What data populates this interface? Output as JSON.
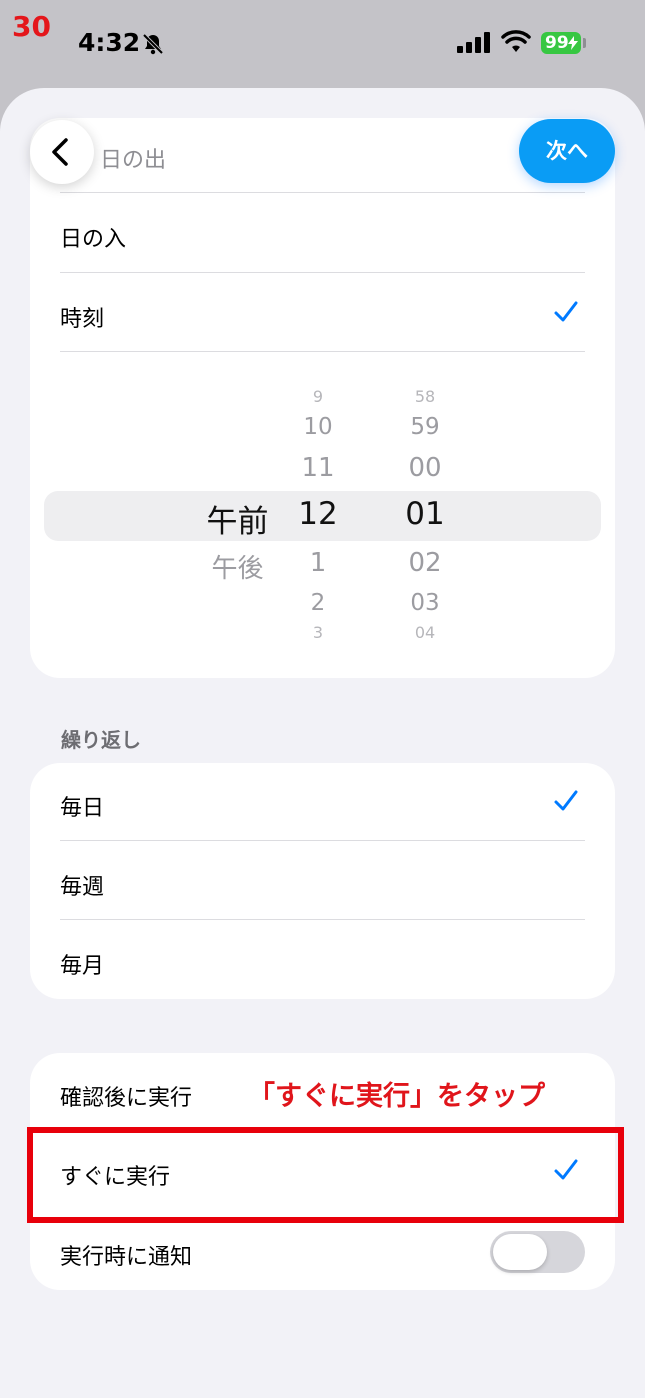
{
  "step_number": "30",
  "status_bar": {
    "time": "4:32",
    "battery": "99"
  },
  "nav": {
    "next_label": "次へ",
    "partial_row_label": "日の出"
  },
  "time_options": [
    {
      "label": "日の入",
      "checked": false
    },
    {
      "label": "時刻",
      "checked": true
    }
  ],
  "time_picker": {
    "period": {
      "above": [],
      "selected": "午前",
      "below": [
        "午後"
      ]
    },
    "hour": {
      "above": [
        "9",
        "10",
        "11"
      ],
      "selected": "12",
      "below": [
        "1",
        "2",
        "3"
      ]
    },
    "minute": {
      "above": [
        "58",
        "59",
        "00"
      ],
      "selected": "01",
      "below": [
        "02",
        "03",
        "04"
      ]
    }
  },
  "repeat": {
    "header": "繰り返し",
    "options": [
      {
        "label": "毎日",
        "checked": true
      },
      {
        "label": "毎週",
        "checked": false
      },
      {
        "label": "毎月",
        "checked": false
      }
    ]
  },
  "run": {
    "options": [
      {
        "label": "確認後に実行",
        "checked": false
      },
      {
        "label": "すぐに実行",
        "checked": true
      }
    ],
    "notify_label": "実行時に通知",
    "notify_on": false
  },
  "annotation": "「すぐに実行」をタップ",
  "colors": {
    "accent": "#007aff",
    "annotation_red": "#e0151b",
    "battery_green": "#37c742"
  }
}
